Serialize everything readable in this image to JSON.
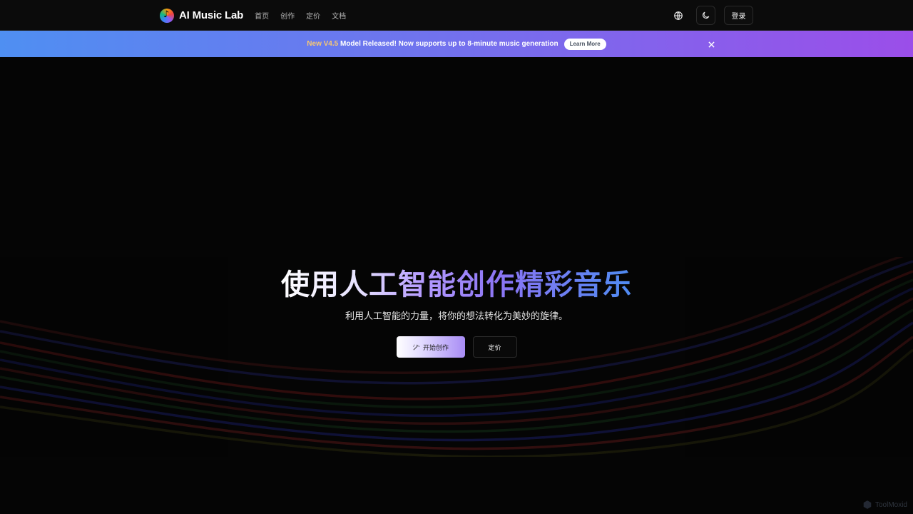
{
  "header": {
    "brand": "AI Music Lab",
    "nav": [
      "首页",
      "创作",
      "定价",
      "文档"
    ],
    "login": "登录",
    "icons": [
      "globe-icon",
      "moon-icon"
    ]
  },
  "banner": {
    "new_label": "New",
    "version": "V4.5",
    "message": "Model Released! Now supports up to 8-minute music generation",
    "learn_more": "Learn More",
    "close_icon": "close-icon"
  },
  "hero": {
    "title": "使用人工智能创作精彩音乐",
    "subtitle": "利用人工智能的力量，将你的想法转化为美妙的旋律。",
    "primary_button": "开始创作",
    "secondary_button": "定价"
  },
  "watermark": "ToolMoxid",
  "colors": {
    "background": "#050505",
    "banner_start": "#4f8ff2",
    "banner_end": "#9b4ee9",
    "accent_purple": "#8b74f4",
    "accent_blue": "#4f8bf2"
  }
}
